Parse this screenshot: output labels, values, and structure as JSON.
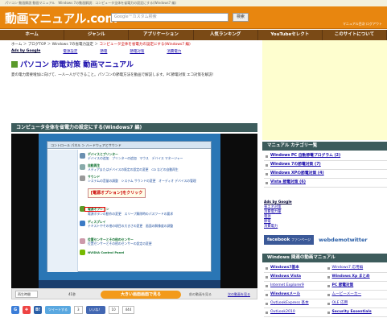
{
  "topline": "パソコン 動画解説 動画マニュアル　Windows 7の動画解説：コンピュータ全体を省電力の設定にする(Windows7 編)",
  "header": {
    "logo": "動画マニュアル.com",
    "search_placeholder": "Google™カスタム検索",
    "search_button": "検索",
    "links": "マニュアル目次  ログアウト"
  },
  "nav": [
    "ホーム",
    "ジャンル",
    "アプリケーション",
    "人気ランキング",
    "YouTubeセレクト",
    "このサイトについて"
  ],
  "breadcrumb": {
    "trail": "ホーム ＞ ブログTOP ＞ Windows 7の省電力設定 ＞ ",
    "current": "コンピュータ全体を省電力の設定にする(Windows7 編)"
  },
  "ads_row": {
    "label": "Ads by Google",
    "links": [
      "電源設定",
      "節電",
      "節電対策",
      "消費電力"
    ]
  },
  "page_title": "パソコン 節電対策 動画マニュアル",
  "description": "夏の電力需要増加に向けて、一人一人ができること。パソコンの節電方法を動画で解説します。PC節電対策 エコ対策を解説！",
  "video": {
    "title": "コンピュータ全体を省電力の設定にする(Windows7 編)",
    "screen": {
      "window_bar": "コントロール パネル ＞ ハードウェアとサウンド",
      "items": [
        {
          "title": "デバイスとプリンター",
          "text": "デバイスの追加　プリンターの追加　マウス　デバイス マネージャー"
        },
        {
          "title": "自動再生",
          "text": "メディアまたはデバイスの既定の設定の変更　CD などの自動再生"
        },
        {
          "title": "サウンド",
          "text": "システムの音量の調整　システム サウンドの変更　オーディオ デバイスの管理"
        },
        {
          "title": "電源オプション",
          "text": "電源ボタンの動作の変更　スリープ解除時のパスワードの要求"
        },
        {
          "title": "ディスプレイ",
          "text": "テキストやその他の項目の大きさの変更　画面の解像度の調整"
        },
        {
          "title": "位置センサーとその他のセンサー",
          "text": "位置センサーとその他のセンサーの設定の変更"
        },
        {
          "title": "NVIDIA Control Panel",
          "text": ""
        }
      ],
      "callout": "[電源オプション]をクリック"
    },
    "controls": {
      "time_label": "再生時間",
      "duration": "41秒",
      "play_large": "大きい画面画面で見る",
      "prev": "前の動画を見る",
      "next": "次の動画を見る"
    }
  },
  "share": {
    "tweet": "ツイートする",
    "tweet_count": "3",
    "like": "いいね！",
    "like_count": "10",
    "hatena": "444"
  },
  "sidebar": {
    "category_title": "マニュアル カテゴリ一覧",
    "categories": [
      "Windows PC 自動節電プログラム (2)",
      "Windows 7の節電対策 (7)",
      "Windows XPの節電対策 (4)",
      "Vista 節電対策 (6)"
    ],
    "ads_label": "Ads by Google",
    "ads_links": [
      "省エネ対策",
      "消費電力量",
      "電源",
      "節電",
      "消費電力"
    ],
    "facebook": "facebook",
    "facebook_sub": "ファンページ",
    "twitter": "webdemotwitter",
    "related_title": "Windows 関連の動画マニュアル",
    "related": [
      {
        "label": "Windows7基本",
        "bold": true
      },
      {
        "label": "Windows7 応用編",
        "bold": false
      },
      {
        "label": "Windows Vista",
        "bold": true
      },
      {
        "label": "Windows Xp まとめ",
        "bold": true
      },
      {
        "label": "Internet Explorer9",
        "bold": false
      },
      {
        "label": "PC 節電対策",
        "bold": true
      },
      {
        "label": "Windowsメール",
        "bold": true
      },
      {
        "label": "ムービーメーカー",
        "bold": false
      },
      {
        "label": "OutLookExpress 基本",
        "bold": false
      },
      {
        "label": "OLE 応用",
        "bold": false
      },
      {
        "label": "OutLook2010",
        "bold": false
      },
      {
        "label": "Security Essentials",
        "bold": true
      }
    ]
  }
}
